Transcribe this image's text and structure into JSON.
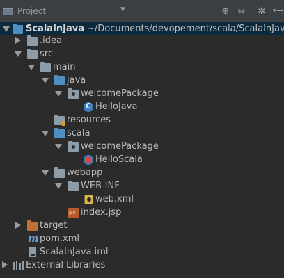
{
  "toolbar": {
    "title": "Project",
    "buttons": [
      "target-icon",
      "collapse-all-icon",
      "gear-icon",
      "hide-icon"
    ]
  },
  "tree": {
    "root_name": "ScalaInJava",
    "root_path": "~/Documents/devopement/scala/ScalaInJava",
    "items": {
      "idea": ".idea",
      "src": "src",
      "main": "main",
      "java": "java",
      "welcome_pkg_java": "welcomePackage",
      "hello_java": "HelloJava",
      "resources": "resources",
      "scala": "scala",
      "welcome_pkg_scala": "welcomePackage",
      "hello_scala": "HelloScala",
      "webapp": "webapp",
      "web_inf": "WEB-INF",
      "web_xml": "web.xml",
      "index_jsp": "index.jsp",
      "target": "target",
      "pom": "pom.xml",
      "iml": "ScalaInJava.iml",
      "external_libraries": "External Libraries"
    }
  },
  "colors": {
    "background": "#2b2b2b",
    "toolbar": "#3c3f41",
    "selection": "#0d293e",
    "source_folder": "#4f8ec1",
    "excluded_folder": "#c0713a"
  }
}
